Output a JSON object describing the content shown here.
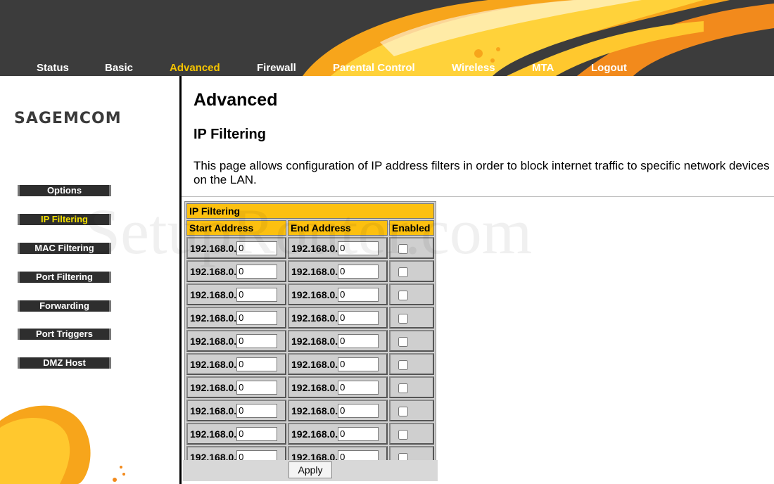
{
  "nav": {
    "items": [
      "Status",
      "Basic",
      "Advanced",
      "Firewall",
      "Parental Control",
      "Wireless",
      "MTA",
      "Logout"
    ],
    "active": "Advanced"
  },
  "logo": "SAGEMCOM",
  "sidebar": {
    "items": [
      "Options",
      "IP Filtering",
      "MAC Filtering",
      "Port Filtering",
      "Forwarding",
      "Port Triggers",
      "DMZ Host"
    ],
    "active": "IP Filtering"
  },
  "content": {
    "page_title": "Advanced",
    "section_title": "IP Filtering",
    "description": "This page allows configuration of IP address filters in order to block internet traffic to specific network devices on the LAN."
  },
  "table": {
    "title": "IP Filtering",
    "headers": [
      "Start Address",
      "End Address",
      "Enabled"
    ],
    "rows": [
      {
        "start_prefix": "192.168.0.",
        "start_value": "0",
        "end_prefix": "192.168.0.",
        "end_value": "0",
        "enabled": false
      },
      {
        "start_prefix": "192.168.0.",
        "start_value": "0",
        "end_prefix": "192.168.0.",
        "end_value": "0",
        "enabled": false
      },
      {
        "start_prefix": "192.168.0.",
        "start_value": "0",
        "end_prefix": "192.168.0.",
        "end_value": "0",
        "enabled": false
      },
      {
        "start_prefix": "192.168.0.",
        "start_value": "0",
        "end_prefix": "192.168.0.",
        "end_value": "0",
        "enabled": false
      },
      {
        "start_prefix": "192.168.0.",
        "start_value": "0",
        "end_prefix": "192.168.0.",
        "end_value": "0",
        "enabled": false
      },
      {
        "start_prefix": "192.168.0.",
        "start_value": "0",
        "end_prefix": "192.168.0.",
        "end_value": "0",
        "enabled": false
      },
      {
        "start_prefix": "192.168.0.",
        "start_value": "0",
        "end_prefix": "192.168.0.",
        "end_value": "0",
        "enabled": false
      },
      {
        "start_prefix": "192.168.0.",
        "start_value": "0",
        "end_prefix": "192.168.0.",
        "end_value": "0",
        "enabled": false
      },
      {
        "start_prefix": "192.168.0.",
        "start_value": "0",
        "end_prefix": "192.168.0.",
        "end_value": "0",
        "enabled": false
      },
      {
        "start_prefix": "192.168.0.",
        "start_value": "0",
        "end_prefix": "192.168.0.",
        "end_value": "0",
        "enabled": false
      }
    ]
  },
  "apply_label": "Apply",
  "watermark": "SetupRouter.com",
  "colors": {
    "header_bg": "#3c3c3c",
    "accent_yellow": "#fcc010",
    "nav_active": "#f5c400",
    "sidebar_button": "#2e2e2e"
  }
}
